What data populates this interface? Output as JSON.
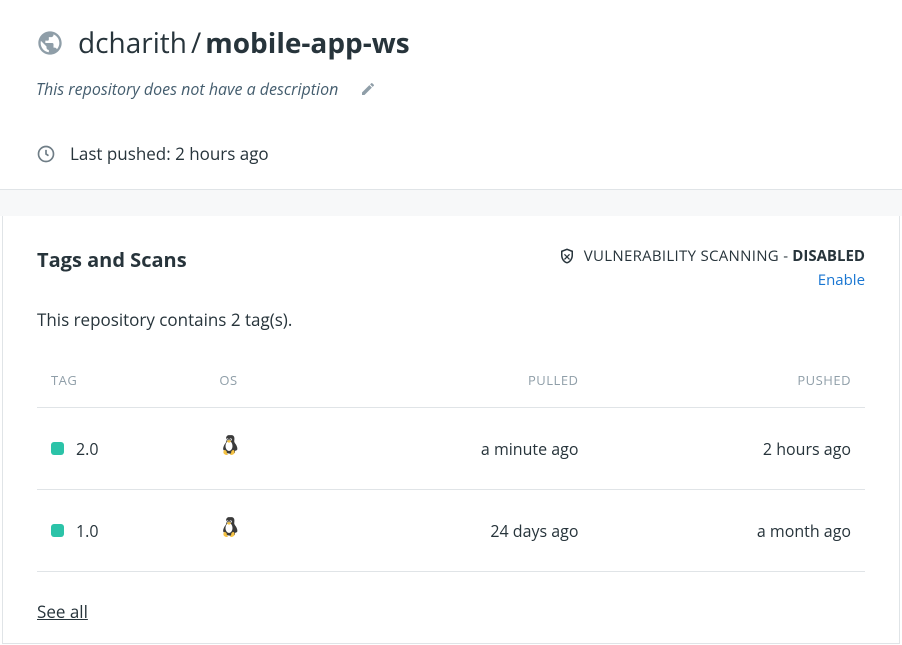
{
  "header": {
    "owner": "dcharith",
    "slash": "/",
    "repo": "mobile-app-ws",
    "description_placeholder": "This repository does not have a description",
    "last_pushed_label": "Last pushed: 2 hours ago"
  },
  "tags_section": {
    "title": "Tags and Scans",
    "vuln_label": "VULNERABILITY SCANNING -",
    "vuln_state": "DISABLED",
    "enable_label": "Enable",
    "tag_count_text": "This repository contains 2 tag(s).",
    "columns": {
      "tag": "TAG",
      "os": "OS",
      "pulled": "PULLED",
      "pushed": "PUSHED"
    },
    "rows": [
      {
        "tag": "2.0",
        "os": "linux",
        "pulled": "a minute ago",
        "pushed": "2 hours ago"
      },
      {
        "tag": "1.0",
        "os": "linux",
        "pulled": "24 days ago",
        "pushed": "a month ago"
      }
    ],
    "see_all": "See all"
  }
}
